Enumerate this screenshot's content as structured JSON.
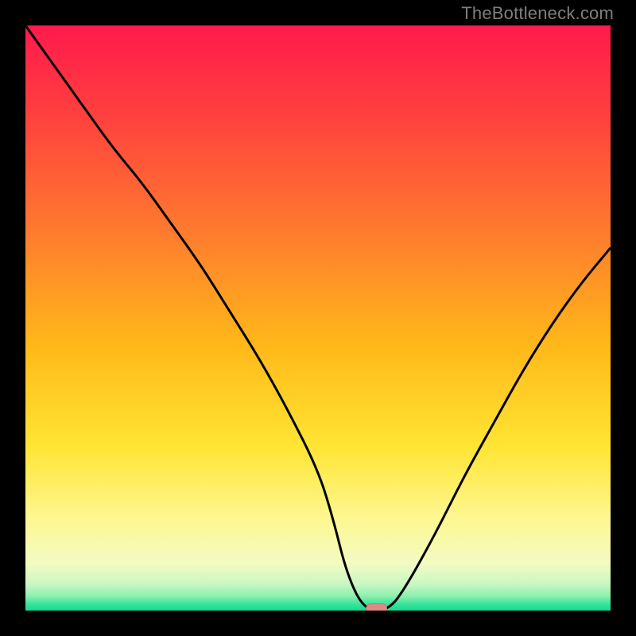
{
  "watermark": "TheBottleneck.com",
  "colors": {
    "frame": "#000000",
    "curve": "#000000",
    "marker_fill": "#dd8a86",
    "marker_stroke": "#c97771",
    "gradient_stops": [
      {
        "offset": 0.0,
        "color": "#ff1a4b"
      },
      {
        "offset": 0.15,
        "color": "#ff3f3f"
      },
      {
        "offset": 0.35,
        "color": "#ff7a2e"
      },
      {
        "offset": 0.55,
        "color": "#ffb919"
      },
      {
        "offset": 0.72,
        "color": "#ffe534"
      },
      {
        "offset": 0.85,
        "color": "#fdf896"
      },
      {
        "offset": 0.92,
        "color": "#f2fbc2"
      },
      {
        "offset": 0.955,
        "color": "#c9f7c2"
      },
      {
        "offset": 0.975,
        "color": "#8ef0b0"
      },
      {
        "offset": 0.99,
        "color": "#33e29a"
      },
      {
        "offset": 1.0,
        "color": "#18da92"
      }
    ]
  },
  "chart_data": {
    "type": "line",
    "title": "",
    "xlabel": "",
    "ylabel": "",
    "x": [
      0.0,
      0.05,
      0.1,
      0.15,
      0.2,
      0.25,
      0.3,
      0.35,
      0.4,
      0.45,
      0.5,
      0.525,
      0.55,
      0.58,
      0.62,
      0.65,
      0.7,
      0.75,
      0.8,
      0.85,
      0.9,
      0.95,
      1.0
    ],
    "values": [
      100,
      93,
      86,
      79,
      73,
      66,
      59,
      51,
      43,
      34,
      24,
      16,
      6,
      0,
      0,
      4,
      13,
      23,
      32,
      41,
      49,
      56,
      62
    ],
    "ylim": [
      0,
      100
    ],
    "xlim": [
      0,
      1
    ],
    "marker": {
      "x": 0.6,
      "y": 0
    }
  }
}
